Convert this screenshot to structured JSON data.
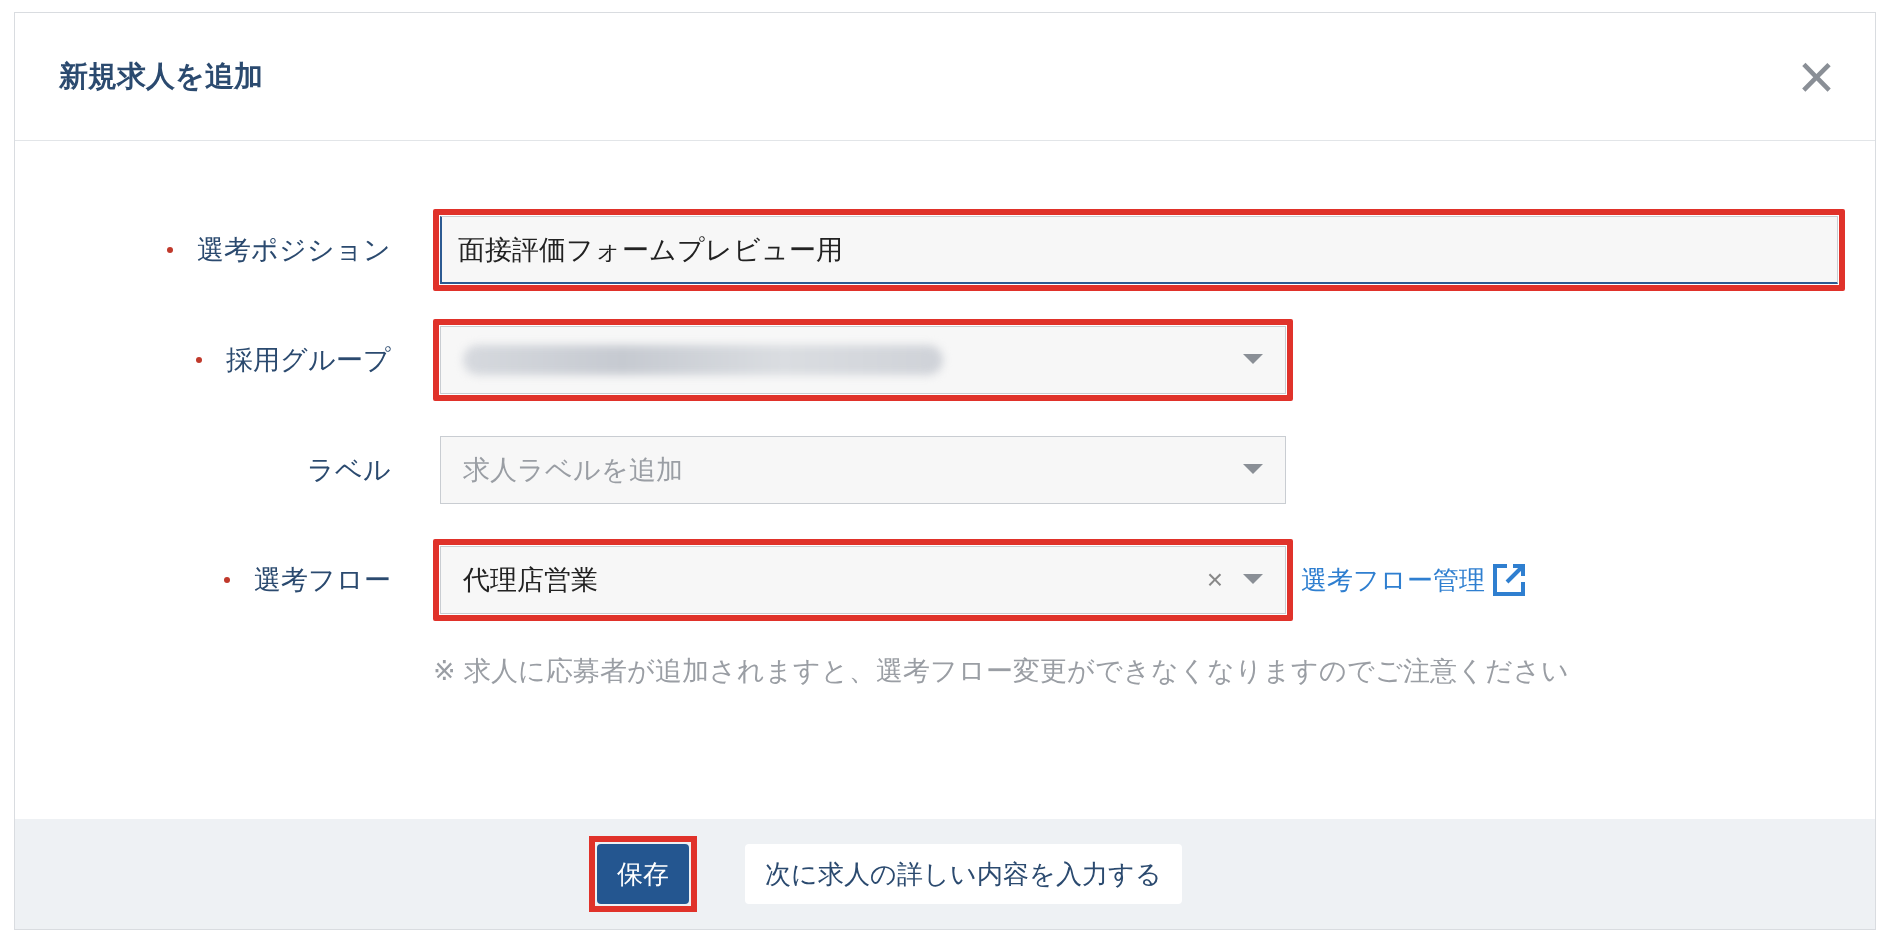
{
  "dialog": {
    "title": "新規求人を追加",
    "close": "×"
  },
  "fields": [
    {
      "kind": "text",
      "label": "選考ポジション",
      "required": true,
      "value": "面接評価フォームプレビュー用",
      "highlighted": true,
      "wide": true
    },
    {
      "kind": "select",
      "label": "採用グループ",
      "required": true,
      "redacted": true,
      "highlighted": true
    },
    {
      "kind": "select",
      "label": "ラベル",
      "required": false,
      "placeholder": "求人ラベルを追加",
      "highlighted": false
    },
    {
      "kind": "select",
      "label": "選考フロー",
      "required": true,
      "value": "代理店営業",
      "clear": "×",
      "highlighted": true,
      "link": "選考フロー管理"
    }
  ],
  "note": "※ 求人に応募者が追加されますと、選考フロー変更ができなくなりますのでご注意ください",
  "buttons": [
    {
      "label": "保存",
      "primary": true,
      "highlighted": true
    },
    {
      "label": "次に求人の詳しい内容を入力する",
      "primary": false,
      "highlighted": false
    }
  ]
}
